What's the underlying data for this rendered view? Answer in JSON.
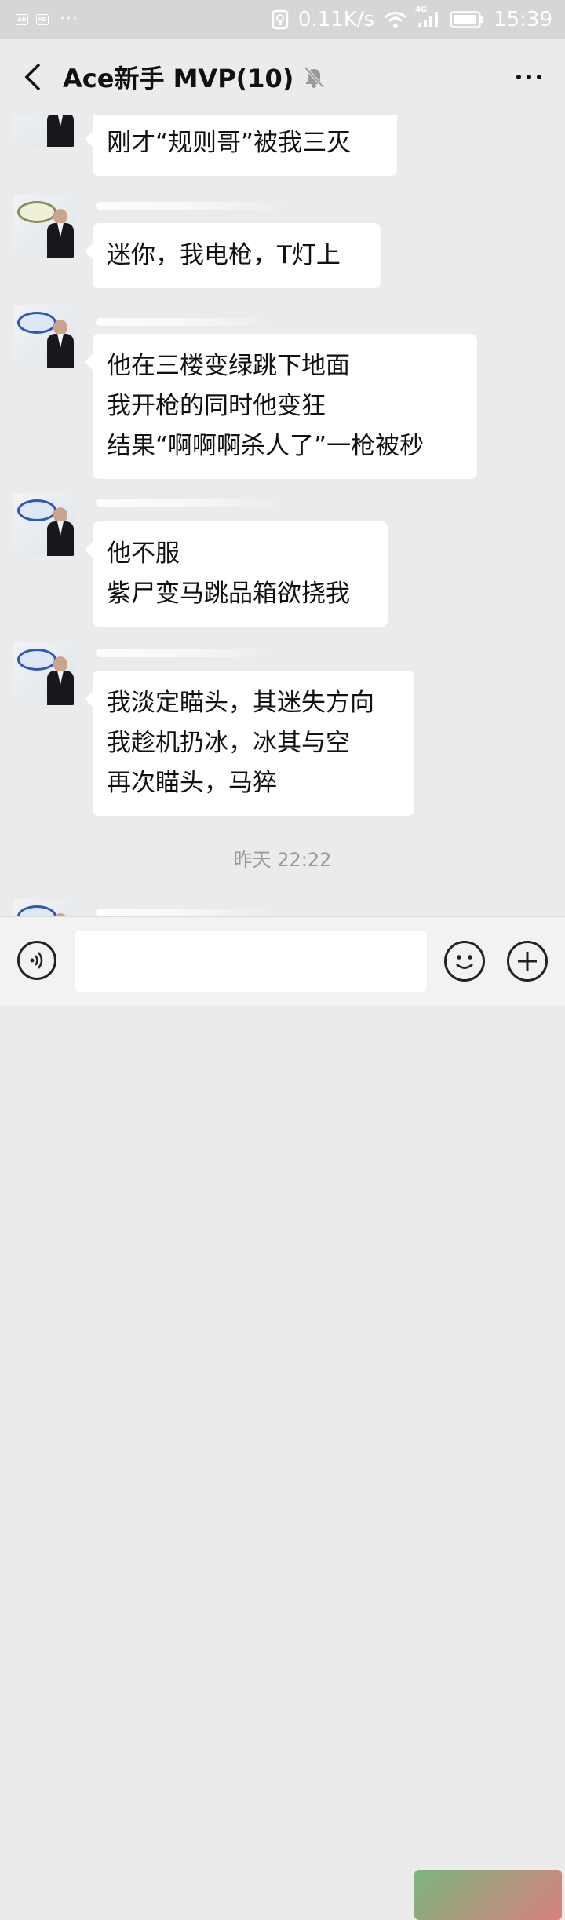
{
  "status_bar": {
    "network_speed": "0.11K/s",
    "network_type": "4G",
    "time": "15:39",
    "icons": [
      "ad-icon",
      "ad-icon",
      "more-dots-icon",
      "data-saver-icon",
      "wifi-icon",
      "signal-icon",
      "battery-icon"
    ]
  },
  "header": {
    "back_icon": "chevron-left-icon",
    "title": "Ace新手 MVP(10)",
    "mute_icon": "bell-muted-icon",
    "more_icon": "more-horizontal-icon"
  },
  "messages": [
    {
      "lines": [
        "刚才“规则哥”被我三灭"
      ]
    },
    {
      "lines": [
        "迷你，我电枪，T灯上"
      ]
    },
    {
      "lines": [
        "他在三楼变绿跳下地面",
        "我开枪的同时他变狂",
        "结果“啊啊啊杀人了”一枪被秒"
      ]
    },
    {
      "lines": [
        "他不服",
        "紫尸变马跳品箱欲挠我"
      ]
    },
    {
      "lines": [
        "我淡定瞄头，其迷失方向",
        "我趁机扔冰，冰其与空",
        "再次瞄头，马猝"
      ]
    }
  ],
  "timestamp": "昨天 22:22",
  "input_bar": {
    "voice_icon": "voice-icon",
    "input_value": "",
    "emoji_icon": "emoji-icon",
    "plus_icon": "plus-circle-icon"
  },
  "colors": {
    "background": "#ebebeb",
    "bubble": "#ffffff",
    "status_bar": "#d6d6d6",
    "logo_blue": "#2f57b3"
  }
}
